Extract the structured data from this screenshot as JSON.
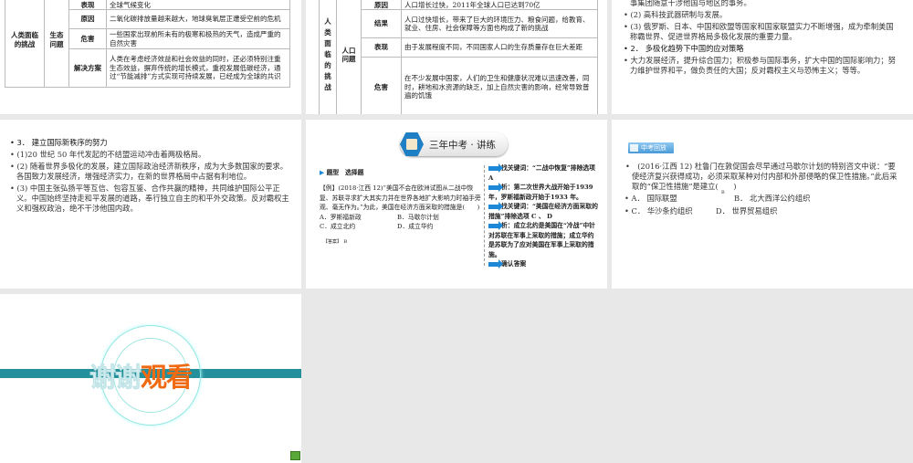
{
  "slides": [
    {
      "challenge": "人类面临的挑战",
      "issue": "生态问题",
      "rows": [
        {
          "label": "表现",
          "text": "全球气候变化"
        },
        {
          "label": "原因",
          "text": "二氧化碳排放量越来越大，地球臭氧层正遭受空前的危机"
        },
        {
          "label": "危害",
          "text": "一些国家出现前所未有的极寒和极热的天气，造成严重的自然灾害"
        },
        {
          "label": "解决方案",
          "text": "人类在考虑经济效益和社会效益的同时，还必须特别注重生态效益，摒弃传统的增长模式，重视发展低碳经济，通过“节能减排”方式实现可持续发展，已经成为全球的共识"
        }
      ]
    },
    {
      "challenge": "人类面临的挑战",
      "issue": "人口问题",
      "rows": [
        {
          "label": "原因",
          "text": "人口增长过快，2011年全球人口已达到70亿"
        },
        {
          "label": "结果",
          "text": "人口过快增长，带来了巨大的环境压力、粮食问题，给教育、就业、住房、社会保障等方面也构成了新的挑战"
        },
        {
          "label": "表现",
          "text": "由于发展程度不同，不同国家人口的生存质量存在巨大差距"
        },
        {
          "label": "危害",
          "text": "在不少发展中国家，人们的卫生和健康状况难以迅速改善，同时，耕地和水资源的缺乏，加上自然灾害的影响，经常导致普遍的饥饿"
        }
      ]
    },
    {
      "lines": [
        {
          "text": "事集团随意干涉他国与地区的事务。",
          "cont": true
        },
        {
          "text": "• (2) 高科技武器研制与发展。"
        },
        {
          "text": "• (3) 俄罗斯、日本、中国和欧盟等国家和国家联盟实力不断增强，成为牵制美国称霸世界、促进世界格局多极化发展的重要力量。"
        },
        {
          "text": "• 2． 多极化趋势下中国的应对策略",
          "heading": true
        },
        {
          "text": "• 大力发展经济，提升综合国力；积极参与国际事务，扩大中国的国际影响力；努力维护世界和平，做负责任的大国；反对霸权主义与恐怖主义；等等。"
        }
      ]
    },
    {
      "lines": [
        {
          "text": "• 3． 建立国际新秩序的努力",
          "heading": true
        },
        {
          "text": "• (1)20 世纪 50 年代发起的不结盟运动冲击着两极格局。"
        },
        {
          "text": "• (2) 随着世界多极化的发展，建立国际政治经济新秩序，成为大多数国家的要求。各国致力发展经济，增强经济实力，在新的世界格局中占据有利地位。"
        },
        {
          "text": "• (3) 中国主张弘扬平等互信、包容互鉴、合作共赢的精神，共同维护国际公平正义。中国始终坚持走和平发展的道路，奉行独立自主的和平外交政策。反对霸权主义和强权政治，绝不干涉他国内政。"
        }
      ]
    },
    {
      "header": "三年中考 · 讲练",
      "type_label": "题型　选择题",
      "question": "【例】(2018·江西 12)“美国不会在欧洲试图从二战中恢复、苏联寻求扩大其实力并在世界各地扩大影响力时袖手旁观、毫无作为。”为此，美国在经济方面采取的措施是(　　)",
      "options": [
        "A．罗斯福新政",
        "B．马歇尔计划",
        "C．成立北约",
        "D．成立华约"
      ],
      "answer_label": "【答案】",
      "answer": "B",
      "steps": [
        "找关键词：“二战中恢复”排除选项 A",
        "析：第二次世界大战开始于1939 年，罗斯福新政开始于1933 年。",
        "找关键词：“美国在经济方面采取的措施”排除选项 C 、 D",
        "析：成立北约是美国在“冷战”中针对苏联在军事上采取的措施；成立华约是苏联为了应对美国在军事上采取的措施。",
        "确认答案"
      ]
    },
    {
      "logo_text": "中考回放",
      "question": "•　(2016·江西 12) 杜鲁门在敦促国会尽早通过马歇尔计划的特别咨文中说：“要使经济复兴获得成功，必须采取某种对付内部和外部侵略的保卫性措施。”此后采取的“保卫性措施”是建立(　　)",
      "answer": "B",
      "options": [
        "• A． 国际联盟",
        "B． 北大西洋公约组织",
        "• C． 华沙条约组织",
        "D． 世界贸易组织"
      ]
    },
    {
      "thanks_white": "谢谢",
      "thanks_orange": "观看"
    }
  ],
  "colors": {
    "teal": "#23909c",
    "orange": "#f06a12",
    "blue": "#1e88d8",
    "gray": "#e8e8e8"
  }
}
